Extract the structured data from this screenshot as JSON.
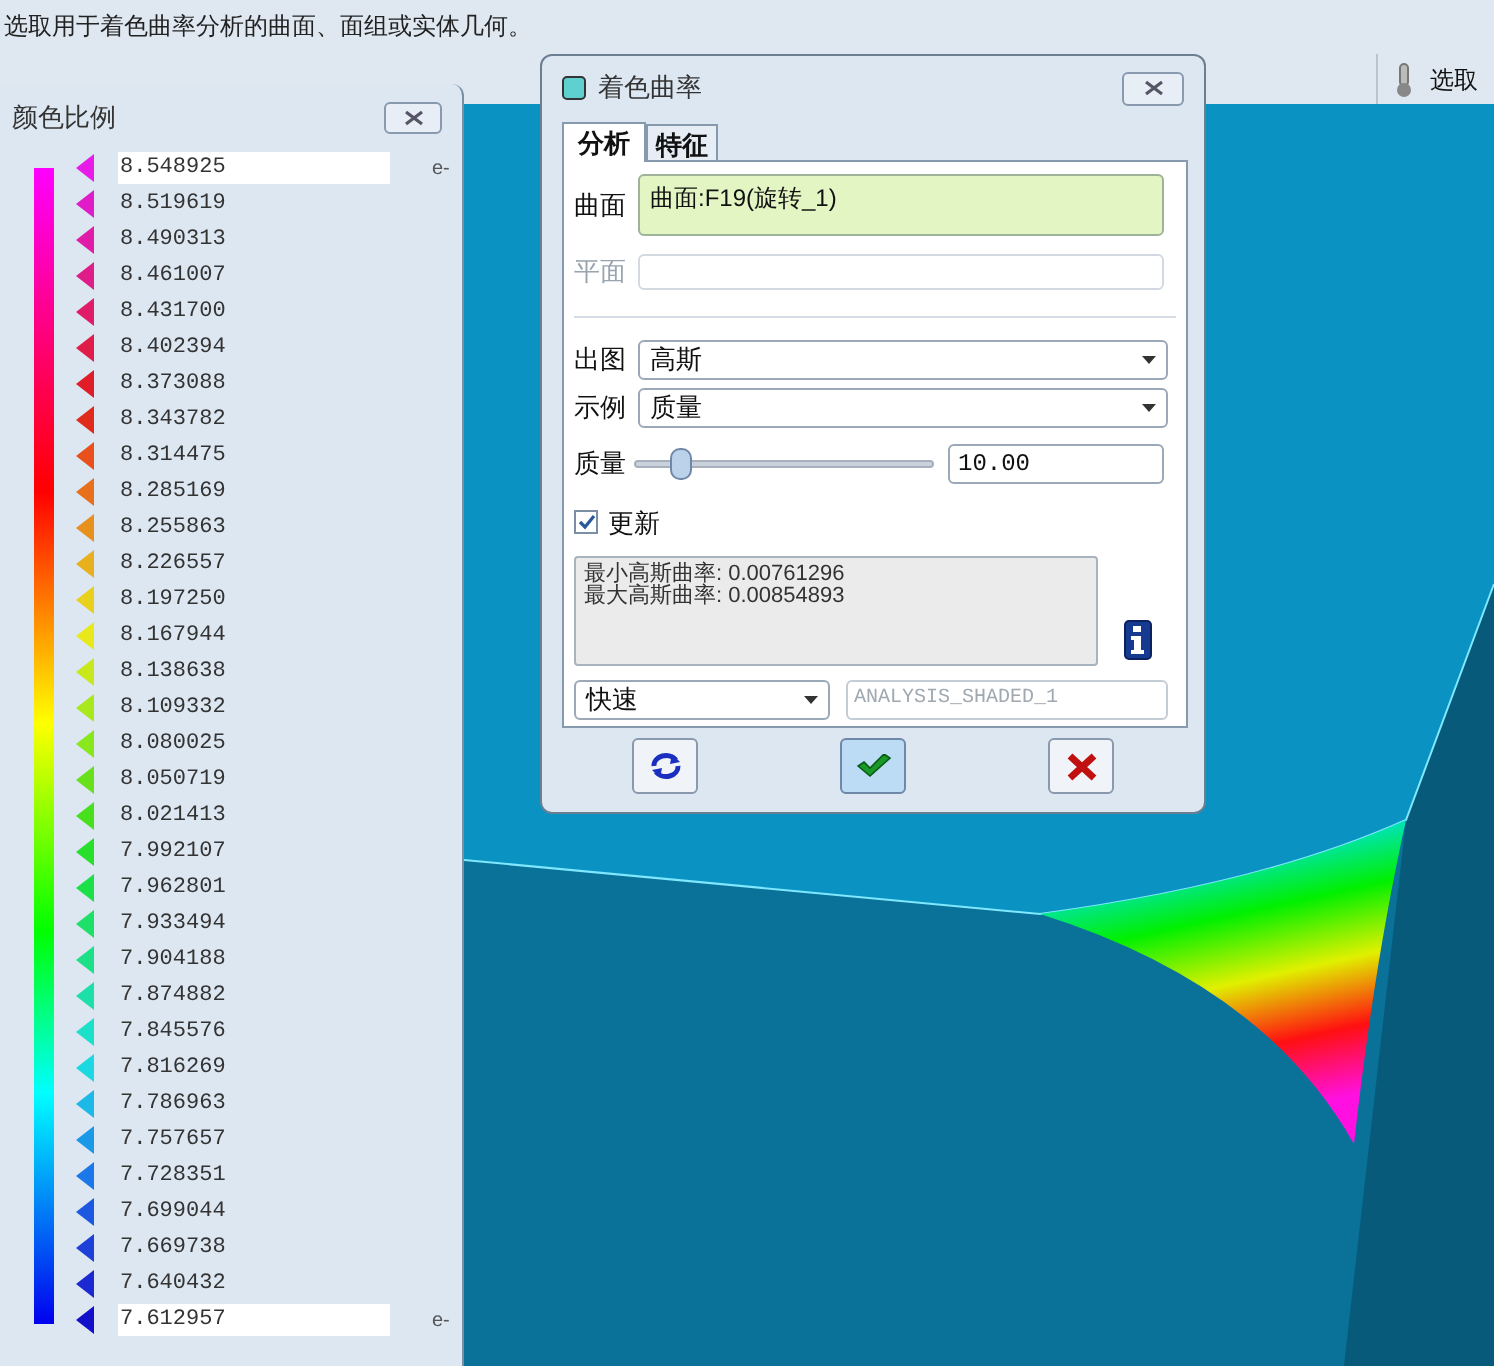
{
  "message": "选取用于着色曲率分析的曲面、面组或实体几何。",
  "toolbar": {
    "label": "选取"
  },
  "legend": {
    "title": "颜色比例",
    "exponent_top": "e-",
    "exponent_bottom": "e-",
    "entries": [
      {
        "kind": "field",
        "value": "8.548925",
        "color": "#e81ce8"
      },
      {
        "kind": "text",
        "value": "8.519619",
        "color": "#e01cc8"
      },
      {
        "kind": "text",
        "value": "8.490313",
        "color": "#e01ca8"
      },
      {
        "kind": "text",
        "value": "8.461007",
        "color": "#e01c88"
      },
      {
        "kind": "text",
        "value": "8.431700",
        "color": "#e01c68"
      },
      {
        "kind": "text",
        "value": "8.402394",
        "color": "#e01c48"
      },
      {
        "kind": "text",
        "value": "8.373088",
        "color": "#e01c28"
      },
      {
        "kind": "text",
        "value": "8.343782",
        "color": "#e02a1c"
      },
      {
        "kind": "text",
        "value": "8.314475",
        "color": "#e8501c"
      },
      {
        "kind": "text",
        "value": "8.285169",
        "color": "#e8701c"
      },
      {
        "kind": "text",
        "value": "8.255863",
        "color": "#e8901c"
      },
      {
        "kind": "text",
        "value": "8.226557",
        "color": "#e8b01c"
      },
      {
        "kind": "text",
        "value": "8.197250",
        "color": "#e8d01c"
      },
      {
        "kind": "text",
        "value": "8.167944",
        "color": "#e8e81c"
      },
      {
        "kind": "text",
        "value": "8.138638",
        "color": "#c8e81c"
      },
      {
        "kind": "text",
        "value": "8.109332",
        "color": "#a8e81c"
      },
      {
        "kind": "text",
        "value": "8.080025",
        "color": "#88e81c"
      },
      {
        "kind": "text",
        "value": "8.050719",
        "color": "#68e01c"
      },
      {
        "kind": "text",
        "value": "8.021413",
        "color": "#48e01c"
      },
      {
        "kind": "text",
        "value": "7.992107",
        "color": "#28e02c"
      },
      {
        "kind": "text",
        "value": "7.962801",
        "color": "#1ce048"
      },
      {
        "kind": "text",
        "value": "7.933494",
        "color": "#1ce068"
      },
      {
        "kind": "text",
        "value": "7.904188",
        "color": "#1ce088"
      },
      {
        "kind": "text",
        "value": "7.874882",
        "color": "#1ce0a8"
      },
      {
        "kind": "text",
        "value": "7.845576",
        "color": "#1ce0c8"
      },
      {
        "kind": "text",
        "value": "7.816269",
        "color": "#1cd8e0"
      },
      {
        "kind": "text",
        "value": "7.786963",
        "color": "#1cb8e8"
      },
      {
        "kind": "text",
        "value": "7.757657",
        "color": "#1c98e8"
      },
      {
        "kind": "text",
        "value": "7.728351",
        "color": "#1c78e8"
      },
      {
        "kind": "text",
        "value": "7.699044",
        "color": "#1c58e0"
      },
      {
        "kind": "text",
        "value": "7.669738",
        "color": "#1c40d8"
      },
      {
        "kind": "text",
        "value": "7.640432",
        "color": "#1c28d0"
      },
      {
        "kind": "field",
        "value": "7.612957",
        "color": "#1010c8"
      }
    ]
  },
  "dialog": {
    "title": "着色曲率",
    "tabs": [
      {
        "label": "分析",
        "selected": true
      },
      {
        "label": "特征",
        "selected": false
      }
    ],
    "surface": {
      "label": "曲面",
      "value": "曲面:F19(旋转_1)"
    },
    "plane": {
      "label": "平面",
      "disabled": true
    },
    "plot": {
      "label": "出图",
      "value": "高斯"
    },
    "example": {
      "label": "示例",
      "value": "质量"
    },
    "quality": {
      "label": "质量",
      "level": 0.12,
      "value": "10.00"
    },
    "update": {
      "label": "更新",
      "checked": true
    },
    "info_lines": [
      "最小高斯曲率: 0.00761296",
      "最大高斯曲率: 0.00854893"
    ],
    "mode": {
      "value": "快速"
    },
    "name_field": {
      "value": "ANALYSIS_SHADED_1",
      "disabled": true
    }
  }
}
